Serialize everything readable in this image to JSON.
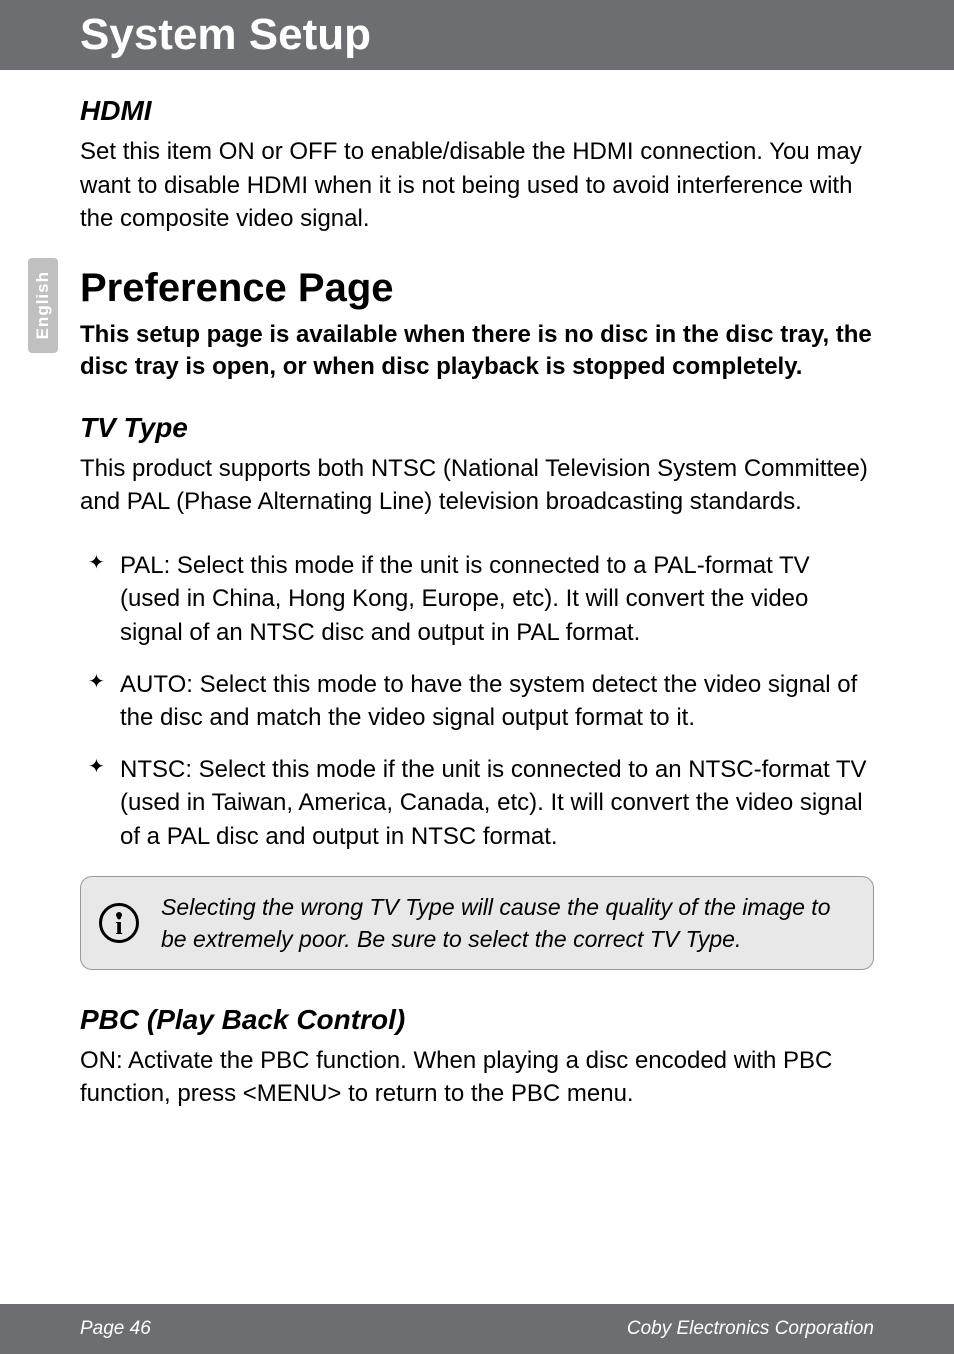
{
  "header": {
    "title": "System Setup"
  },
  "sideTab": {
    "label": "English"
  },
  "sections": {
    "hdmi": {
      "heading": "HDMI",
      "body": "Set this item ON or OFF to enable/disable the HDMI connection. You may want to disable HDMI when it is not being used to avoid interference with the composite video signal."
    },
    "preference": {
      "heading": "Preference Page",
      "note": "This setup page is available when there is no disc in the disc tray, the disc tray is open, or when disc playback is stopped completely."
    },
    "tvType": {
      "heading": "TV Type",
      "body": "This product supports both NTSC (National Television System Committee) and PAL (Phase Alternating Line) television broadcasting standards.",
      "bullets": [
        "PAL: Select this mode if the unit is connected to a PAL-format TV (used in China, Hong Kong, Europe, etc). It will convert the video signal of an NTSC disc and output in PAL format.",
        "AUTO: Select this mode to have the system detect the video signal of the disc and match the video signal output format to it.",
        "NTSC: Select this mode if the unit is connected to an NTSC-format TV (used in Taiwan, America, Canada, etc). It will convert the video signal of a PAL disc and output in NTSC format."
      ],
      "infoBox": "Selecting the wrong TV Type will cause the quality of the image to be extremely poor. Be sure to select the correct TV Type."
    },
    "pbc": {
      "heading": "PBC (Play Back Control)",
      "body": "ON: Activate the PBC function. When playing a disc encoded with PBC function, press <MENU> to return to the PBC menu."
    }
  },
  "footer": {
    "left": "Page 46",
    "right": "Coby Electronics Corporation"
  }
}
